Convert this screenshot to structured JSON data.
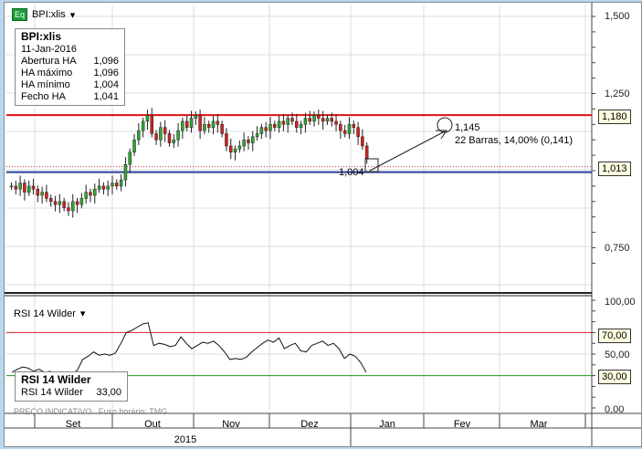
{
  "header": {
    "symbol": "BPI:xlis",
    "icon": "Eq"
  },
  "legend": {
    "title": "BPI:xlis",
    "date": "11-Jan-2016",
    "rows": [
      {
        "label": "Abertura HA",
        "value": "1,096"
      },
      {
        "label": "HA máximo",
        "value": "1,096"
      },
      {
        "label": "HA mínimo",
        "value": "1,004"
      },
      {
        "label": "Fecho HA",
        "value": "1,041"
      }
    ]
  },
  "rsi_header": "RSI 14 Wilder",
  "rsi_legend": {
    "title": "RSI 14 Wilder",
    "label": "RSI 14 Wilder",
    "value": "33,00"
  },
  "footer": {
    "price_note": "PREÇO INDICATIVO",
    "timezone": "Fuso horário: TMG"
  },
  "annotation": {
    "target": "1,145",
    "summary": "22 Barras, 14,00% (0,141)",
    "low": "1,004"
  },
  "tags": {
    "resistance": "1,180",
    "current": "1,013",
    "rsi_high": "70,00",
    "rsi_low": "30,00"
  },
  "colors": {
    "resistance": "#e01010",
    "support": "#2a3f9a",
    "up": "#2fa82f",
    "down": "#d42020",
    "rsi_high": "#d42020",
    "rsi_low": "#1a9a1a"
  },
  "chart_data": [
    {
      "type": "candlestick",
      "title": "BPI:xlis",
      "ylim": [
        0.7,
        1.55
      ],
      "yticks": [
        "1,500",
        "1,250",
        "0,750"
      ],
      "ytick_values": [
        1.5,
        1.25,
        0.75
      ],
      "horizontal_lines": [
        1.18,
        1.004
      ],
      "closes": [
        0.95,
        0.94,
        0.96,
        0.93,
        0.95,
        0.94,
        0.92,
        0.93,
        0.91,
        0.9,
        0.89,
        0.9,
        0.88,
        0.87,
        0.9,
        0.89,
        0.91,
        0.93,
        0.92,
        0.94,
        0.95,
        0.94,
        0.95,
        0.96,
        0.95,
        0.97,
        1.02,
        1.06,
        1.1,
        1.13,
        1.16,
        1.18,
        1.12,
        1.1,
        1.14,
        1.12,
        1.09,
        1.1,
        1.13,
        1.16,
        1.14,
        1.17,
        1.18,
        1.13,
        1.15,
        1.14,
        1.16,
        1.15,
        1.12,
        1.08,
        1.06,
        1.07,
        1.08,
        1.1,
        1.09,
        1.11,
        1.12,
        1.14,
        1.13,
        1.15,
        1.14,
        1.16,
        1.15,
        1.17,
        1.16,
        1.14,
        1.15,
        1.17,
        1.16,
        1.18,
        1.17,
        1.16,
        1.17,
        1.16,
        1.15,
        1.13,
        1.12,
        1.15,
        1.14,
        1.11,
        1.08,
        1.04
      ]
    },
    {
      "type": "line",
      "title": "RSI 14 Wilder",
      "ylim": [
        0,
        100
      ],
      "yticks": [
        "100,00",
        "70,00",
        "50,00",
        "30,00",
        "0,00"
      ],
      "ytick_values": [
        100,
        70,
        50,
        30,
        0
      ],
      "values": [
        33,
        36,
        38,
        37,
        34,
        36,
        33,
        34,
        32,
        33,
        32,
        31,
        35,
        45,
        48,
        52,
        49,
        50,
        49,
        51,
        60,
        70,
        72,
        75,
        78,
        79,
        58,
        60,
        59,
        57,
        58,
        66,
        60,
        55,
        58,
        61,
        60,
        62,
        58,
        52,
        45,
        46,
        45,
        47,
        52,
        56,
        60,
        63,
        61,
        65,
        55,
        58,
        60,
        53,
        52,
        58,
        60,
        62,
        58,
        60,
        55,
        46,
        50,
        48,
        42,
        33
      ]
    }
  ],
  "xaxis": {
    "months": [
      "Set",
      "Out",
      "Nov",
      "Dez",
      "Jan",
      "Fev",
      "Mar"
    ],
    "year": "2015"
  }
}
